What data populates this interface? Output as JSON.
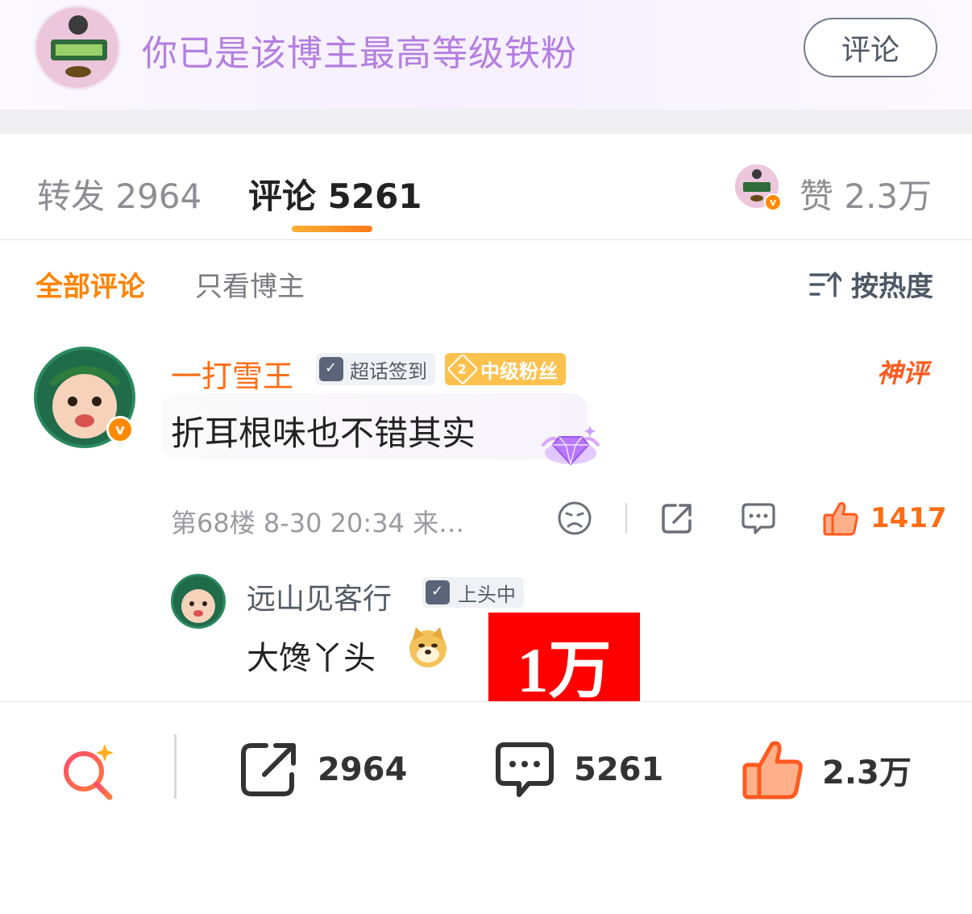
{
  "banner": {
    "text": "你已是该博主最高等级铁粉",
    "comment_button": "评论"
  },
  "tabs": {
    "repost": "转发 2964",
    "comment": "评论 5261",
    "like": "赞 2.3万"
  },
  "filter": {
    "all": "全部评论",
    "blogger_only": "只看博主",
    "sort": "按热度"
  },
  "comment": {
    "author": "一打雪王",
    "badge_checkin": "超话签到",
    "fan_level": "2",
    "badge_fan": "中级粉丝",
    "tag": "神评",
    "text": "折耳根味也不错其实",
    "meta": "第68楼 8-30 20:34 来…",
    "like_count": "1417"
  },
  "reply": {
    "author": "远山见客行",
    "badge": "上头中",
    "text": "大馋丫头"
  },
  "overlay": {
    "text": "1万"
  },
  "bottom_bar": {
    "repost_count": "2964",
    "comment_count": "5261",
    "like_count": "2.3万"
  },
  "colors": {
    "accent_orange": "#ff8200",
    "banner_purple": "#b47fe0",
    "overlay_red": "#ff0000"
  },
  "icons": [
    "search-ai-icon",
    "share-icon",
    "comment-icon",
    "thumbs-up-icon",
    "dislike-face-icon",
    "sort-icon",
    "calendar-check-icon",
    "gem-icon",
    "doge-emoji-icon",
    "verified-v-icon"
  ]
}
